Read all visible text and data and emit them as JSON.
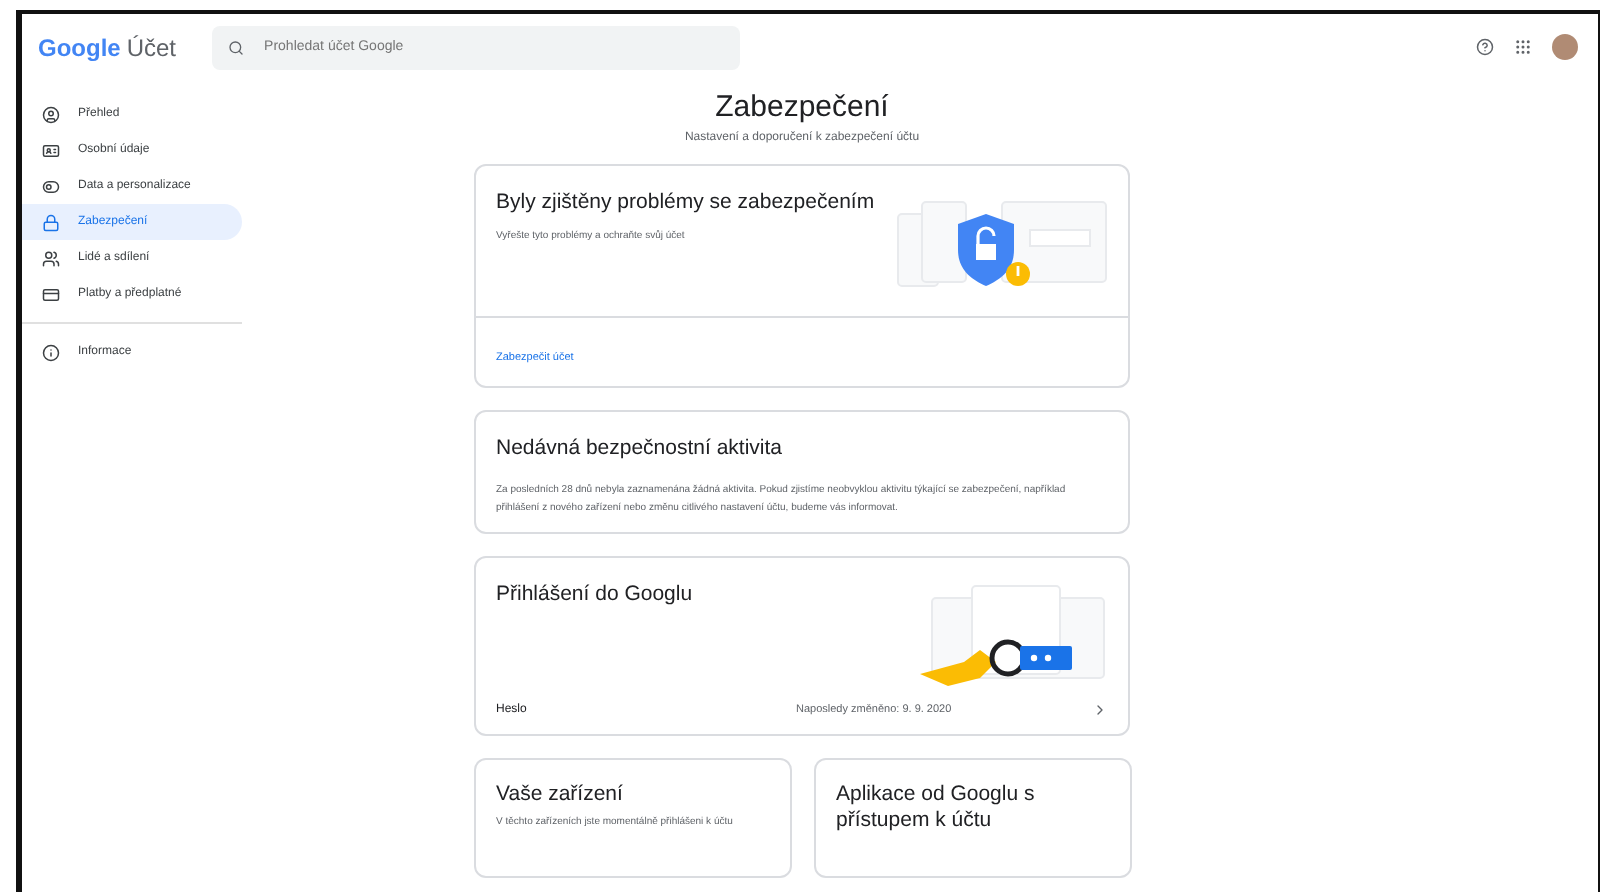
{
  "header": {
    "logo_brand": "Google",
    "logo_product": "Účet",
    "search": {
      "placeholder": "Prohledat účet Google"
    }
  },
  "sidebar": {
    "items": [
      {
        "label": "Přehled",
        "selected": false
      },
      {
        "label": "Osobní údaje",
        "selected": false
      },
      {
        "label": "Data a personalizace",
        "selected": false
      },
      {
        "label": "Zabezpečení",
        "selected": true
      },
      {
        "label": "Lidé a sdílení",
        "selected": false
      },
      {
        "label": "Platby a předplatné",
        "selected": false
      }
    ],
    "footer_items": [
      {
        "label": "Informace",
        "selected": false
      }
    ]
  },
  "page": {
    "title": "Zabezpečení",
    "subtitle": "Nastavení a doporučení k zabezpečení účtu"
  },
  "issues_card": {
    "title": "Byly zjištěny problémy se zabezpečením",
    "text": "Vyřešte tyto problémy a ochraňte svůj účet",
    "link": "Zabezpečit účet"
  },
  "activity_card": {
    "title": "Nedávná bezpečnostní aktivita",
    "text": "Za posledních 28 dnů nebyla zaznamenána žádná aktivita. Pokud zjistíme neobvyklou aktivitu týkající se zabezpečení, například přihlášení z nového zařízení nebo změnu citlivého nastavení účtu, budeme vás informovat."
  },
  "signin_card": {
    "title": "Přihlášení do Googlu",
    "rows": [
      {
        "label": "Heslo",
        "value": "Naposledy změněno: 9. 9. 2020"
      }
    ]
  },
  "devices_card": {
    "title": "Vaše zařízení",
    "text": "V těchto zařízeních jste momentálně přihlášeni k účtu"
  },
  "apps_card": {
    "title": "Aplikace od Googlu s přístupem k účtu"
  }
}
